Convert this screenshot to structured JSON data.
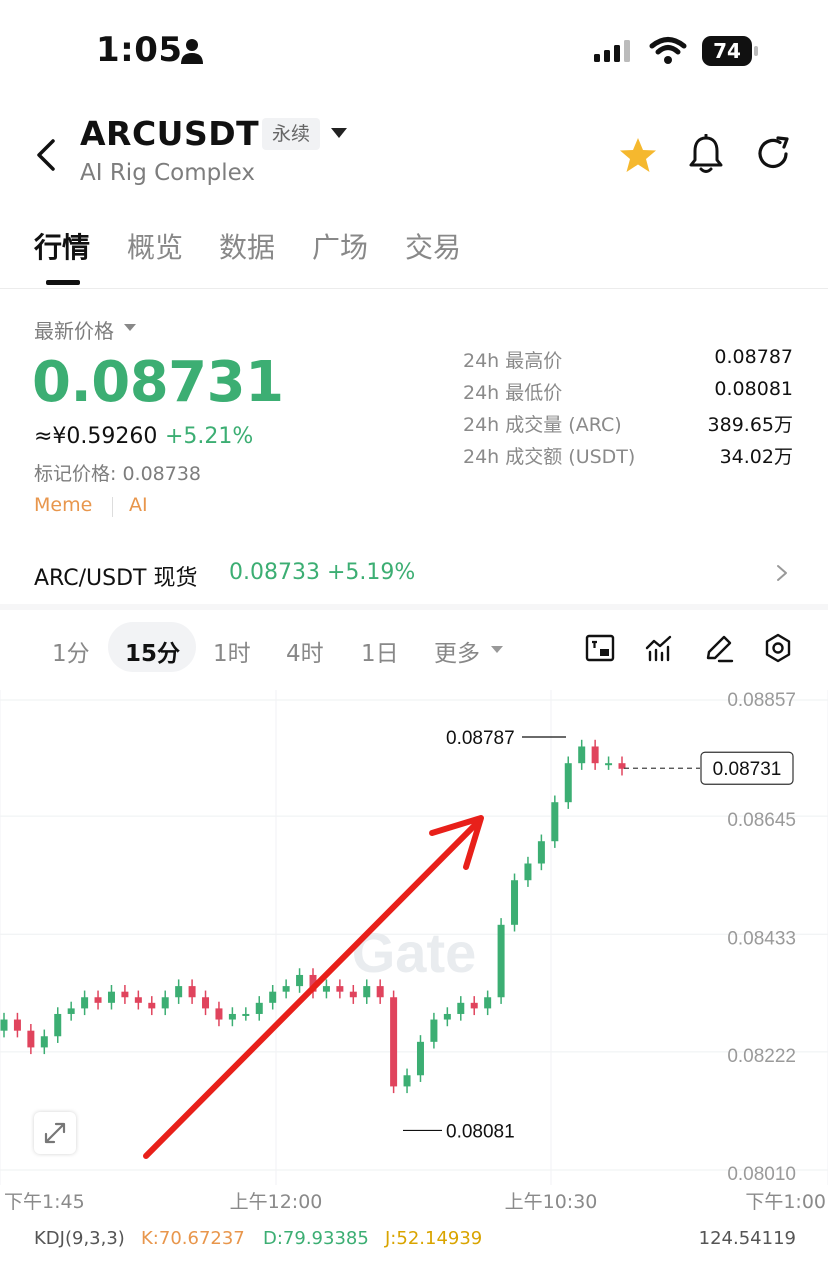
{
  "status": {
    "time": "1:05",
    "battery": "74"
  },
  "header": {
    "symbol": "ARCUSDT",
    "contract_type": "永续",
    "name": "AI Rig Complex"
  },
  "tabs": [
    "行情",
    "概览",
    "数据",
    "广场",
    "交易"
  ],
  "price": {
    "label": "最新价格",
    "last": "0.08731",
    "cny": "≈¥0.59260",
    "change": "+5.21%",
    "mark": "标记价格: 0.08738",
    "tags": [
      "Meme",
      "AI"
    ]
  },
  "stats": [
    {
      "label": "24h 最高价",
      "value": "0.08787"
    },
    {
      "label": "24h 最低价",
      "value": "0.08081"
    },
    {
      "label": "24h 成交量 (ARC)",
      "value": "389.65万"
    },
    {
      "label": "24h 成交额 (USDT)",
      "value": "34.02万"
    }
  ],
  "spot": {
    "label": "ARC/USDT 现货",
    "price": "0.08733",
    "change": "+5.19%"
  },
  "intervals": [
    "1分",
    "15分",
    "1时",
    "4时",
    "1日",
    "更多"
  ],
  "active_interval": "15分",
  "colors": {
    "up": "#3cae73",
    "down": "#e0445d",
    "accent": "#e8964c",
    "arrow": "#e8201a"
  },
  "icons": [
    "back-icon",
    "star-icon",
    "bell-icon",
    "refresh-icon",
    "chevron-right-icon",
    "chart-type-icon",
    "indicator-icon",
    "draw-icon",
    "settings-icon",
    "expand-icon"
  ],
  "chart_data": {
    "type": "candlestick",
    "y_ticks": [
      "0.08857",
      "0.08645",
      "0.08433",
      "0.08222",
      "0.08010"
    ],
    "x_ticks": [
      "下午1:45",
      "上午12:00",
      "上午10:30",
      "下午1:00"
    ],
    "high_label": "0.08787",
    "low_label": "0.08081",
    "last_label": "0.08731",
    "watermark": "Gate",
    "ylim": [
      0.0801,
      0.08857
    ],
    "close_trend": [
      0.0828,
      0.0826,
      0.0823,
      0.0825,
      0.0829,
      0.083,
      0.0832,
      0.0831,
      0.0833,
      0.0832,
      0.0831,
      0.083,
      0.0832,
      0.0834,
      0.0832,
      0.083,
      0.0828,
      0.0829,
      0.0829,
      0.0831,
      0.0833,
      0.0834,
      0.0836,
      0.0833,
      0.0834,
      0.0833,
      0.0832,
      0.0834,
      0.0832,
      0.0816,
      0.0818,
      0.0824,
      0.0828,
      0.0829,
      0.0831,
      0.083,
      0.0832,
      0.0845,
      0.0853,
      0.0856,
      0.086,
      0.0867,
      0.0874,
      0.0877,
      0.0874,
      0.0874,
      0.0873
    ]
  },
  "kdj": {
    "label": "KDJ(9,3,3)",
    "k": "K:70.67237",
    "d": "D:79.93385",
    "j": "J:52.14939",
    "right": "124.54119"
  }
}
